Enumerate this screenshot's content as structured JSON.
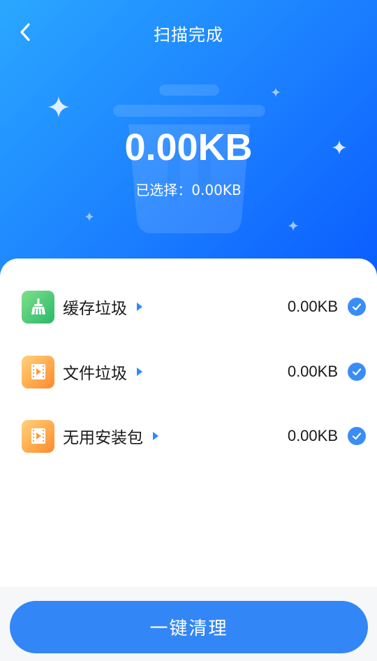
{
  "header": {
    "title": "扫描完成"
  },
  "summary": {
    "total_size": "0.00KB",
    "selected_text": "已选择：0.00KB"
  },
  "items": [
    {
      "label": "缓存垃圾",
      "size": "0.00KB",
      "icon": "broom-icon",
      "checked": true
    },
    {
      "label": "文件垃圾",
      "size": "0.00KB",
      "icon": "film-icon",
      "checked": true
    },
    {
      "label": "无用安装包",
      "size": "0.00KB",
      "icon": "film-icon",
      "checked": true
    }
  ],
  "action": {
    "clean_label": "一键清理"
  },
  "colors": {
    "hero_start": "#2aa7ff",
    "hero_end": "#0b5dff",
    "accent": "#3386f5",
    "check": "#3a8cf6"
  }
}
